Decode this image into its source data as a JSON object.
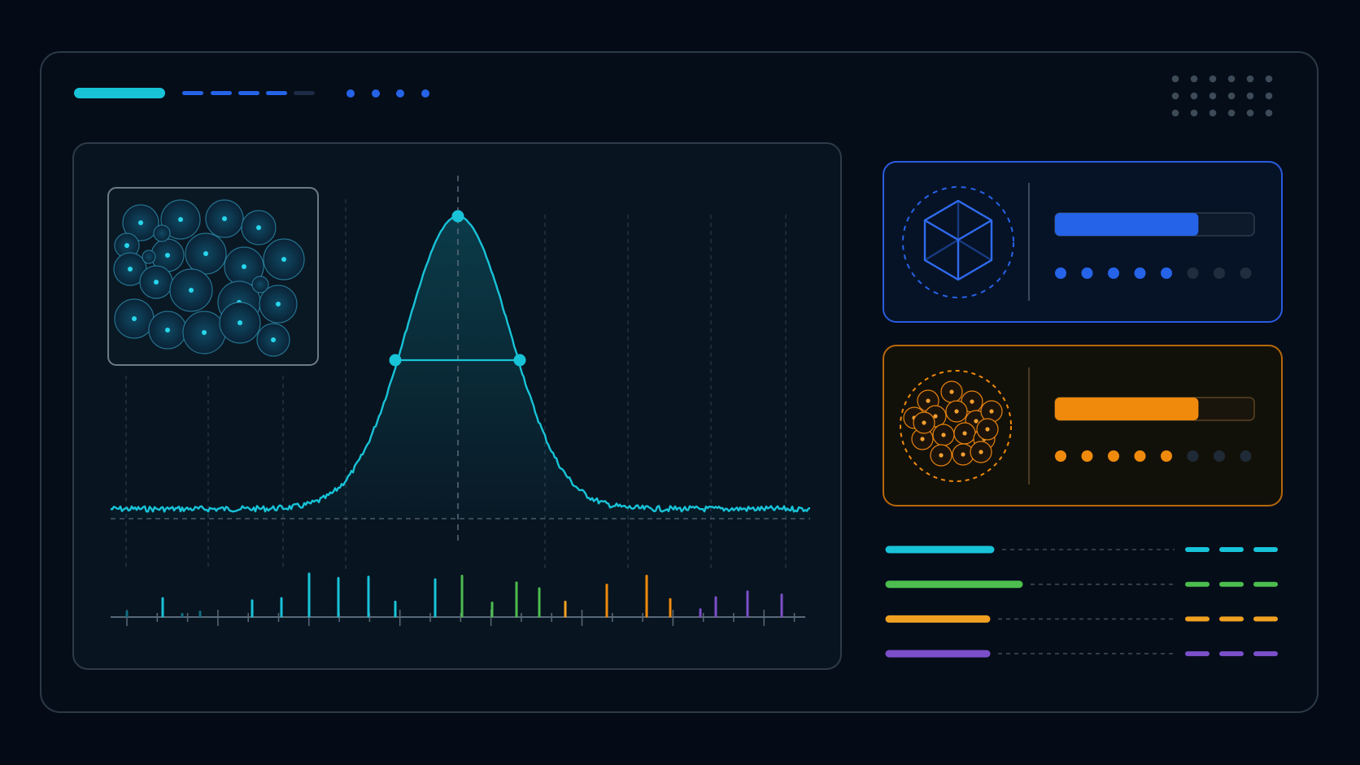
{
  "theme": {
    "background": "#040b16",
    "frame_border": "#2c3947",
    "panel_border": "#2e3b48",
    "accent_cyan": "#18c3d8",
    "accent_blue": "#2563e8",
    "accent_orange": "#f08a0c",
    "accent_green": "#4cbd4e",
    "accent_purple": "#7b4fc9",
    "dim_dot": "#243447"
  },
  "header": {
    "indicator_icons": [
      "progress-pill",
      "dash-segments",
      "dot-indicators"
    ],
    "grid_icon": "dot-grid-icon"
  },
  "main_panel": {
    "thumbnail_icon": "cell-cluster-icon",
    "peak_markers": [
      "peak-top",
      "half-max-left",
      "half-max-right"
    ]
  },
  "chart_data": {
    "type": "line",
    "series": [
      {
        "values": "gaussian-peak"
      }
    ],
    "peak": {
      "x": 0,
      "y": 1.0
    },
    "half_width_points": [
      -0.5,
      0.5
    ],
    "baseline": 0.0,
    "grid": true,
    "title": "",
    "xlabel": "",
    "ylabel": ""
  },
  "spikes": {
    "values": [
      0.1,
      0.4,
      0.05,
      0.1,
      0.35,
      0.4,
      0.95,
      0.85,
      0.88,
      0.32,
      0.82,
      0.9,
      0.3,
      0.75,
      0.62,
      0.32,
      0.7,
      0.9,
      0.38,
      0.15,
      0.42,
      0.55,
      0.48
    ],
    "colors": [
      "#0e6d80",
      "#18c3d8",
      "#0e6d80",
      "#0e6d80",
      "#18c3d8",
      "#18c3d8",
      "#18c3d8",
      "#18c3d8",
      "#18c3d8",
      "#18c3d8",
      "#18c3d8",
      "#4cbd4e",
      "#4cbd4e",
      "#4cbd4e",
      "#4cbd4e",
      "#f0a020",
      "#f08a0c",
      "#f08a0c",
      "#f08a0c",
      "#7b4fc9",
      "#7b4fc9",
      "#7b4fc9",
      "#7b4fc9"
    ]
  },
  "cards": [
    {
      "icon": "cube-icon",
      "progress": 0.72,
      "dots_active": 5,
      "dots_total": 8
    },
    {
      "icon": "cell-cluster-icon",
      "progress": 0.72,
      "dots_active": 5,
      "dots_total": 8
    }
  ],
  "legend_rows": [
    {
      "color": "#18c3d8",
      "fill": 0.25
    },
    {
      "color": "#4cbd4e",
      "fill": 0.32
    },
    {
      "color": "#f0a020",
      "fill": 0.24
    },
    {
      "color": "#7b4fc9",
      "fill": 0.24
    }
  ]
}
